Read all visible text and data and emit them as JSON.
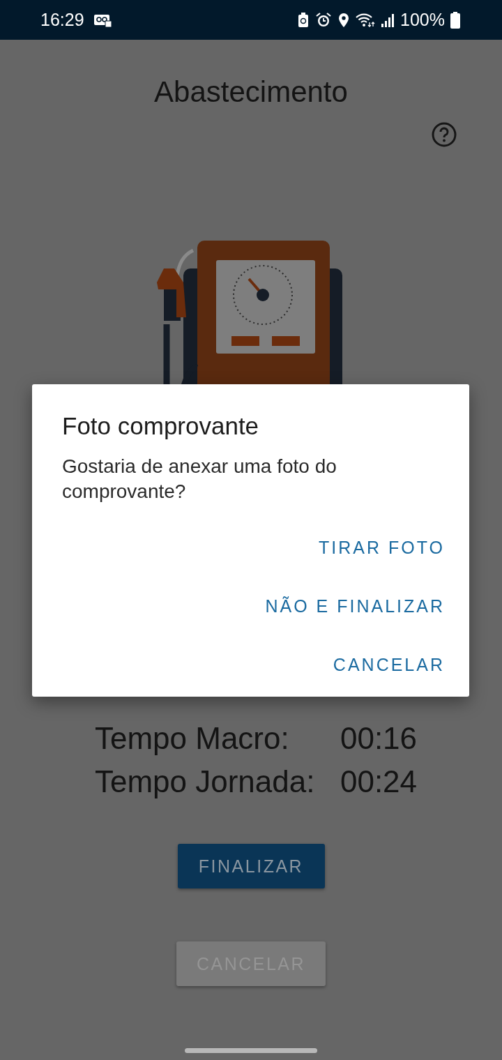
{
  "status_bar": {
    "time": "16:29",
    "battery": "100%"
  },
  "title": "Abastecimento",
  "stats": [
    {
      "label": "Tempo Macro:",
      "value": "00:16"
    },
    {
      "label": "Tempo Jornada:",
      "value": "00:24"
    }
  ],
  "buttons": [
    {
      "label": "FINALIZAR",
      "kind": "primary"
    },
    {
      "label": "CANCELAR",
      "kind": "secondary"
    }
  ],
  "dialog": {
    "title": "Foto comprovante",
    "message": "Gostaria de anexar uma foto do comprovante?",
    "actions": [
      "TIRAR FOTO",
      "NÃO E FINALIZAR",
      "CANCELAR"
    ]
  }
}
